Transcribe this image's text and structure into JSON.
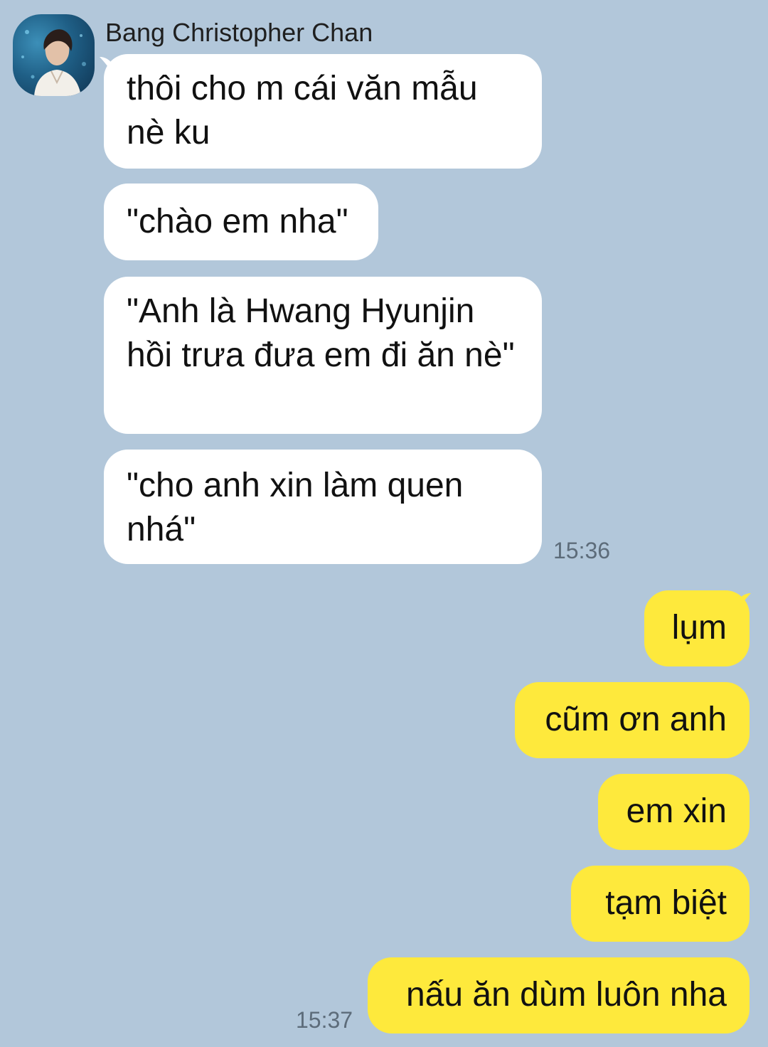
{
  "chat": {
    "sender_name": "Bang Christopher Chan",
    "incoming": [
      "thôi cho m cái văn mẫu nè ku",
      "\"chào em nha\"",
      "\"Anh là Hwang Hyunjin hồi trưa đưa em đi ăn nè\"",
      "\"cho anh xin làm quen nhá\""
    ],
    "incoming_time": "15:36",
    "outgoing": [
      "lụm",
      "cũm ơn anh",
      "em xin",
      "tạm biệt",
      "nấu ăn dùm luôn nha"
    ],
    "outgoing_time": "15:37"
  },
  "colors": {
    "background": "#b2c7da",
    "incoming_bubble": "#ffffff",
    "outgoing_bubble": "#fee93c",
    "timestamp": "#5d6c7a"
  }
}
